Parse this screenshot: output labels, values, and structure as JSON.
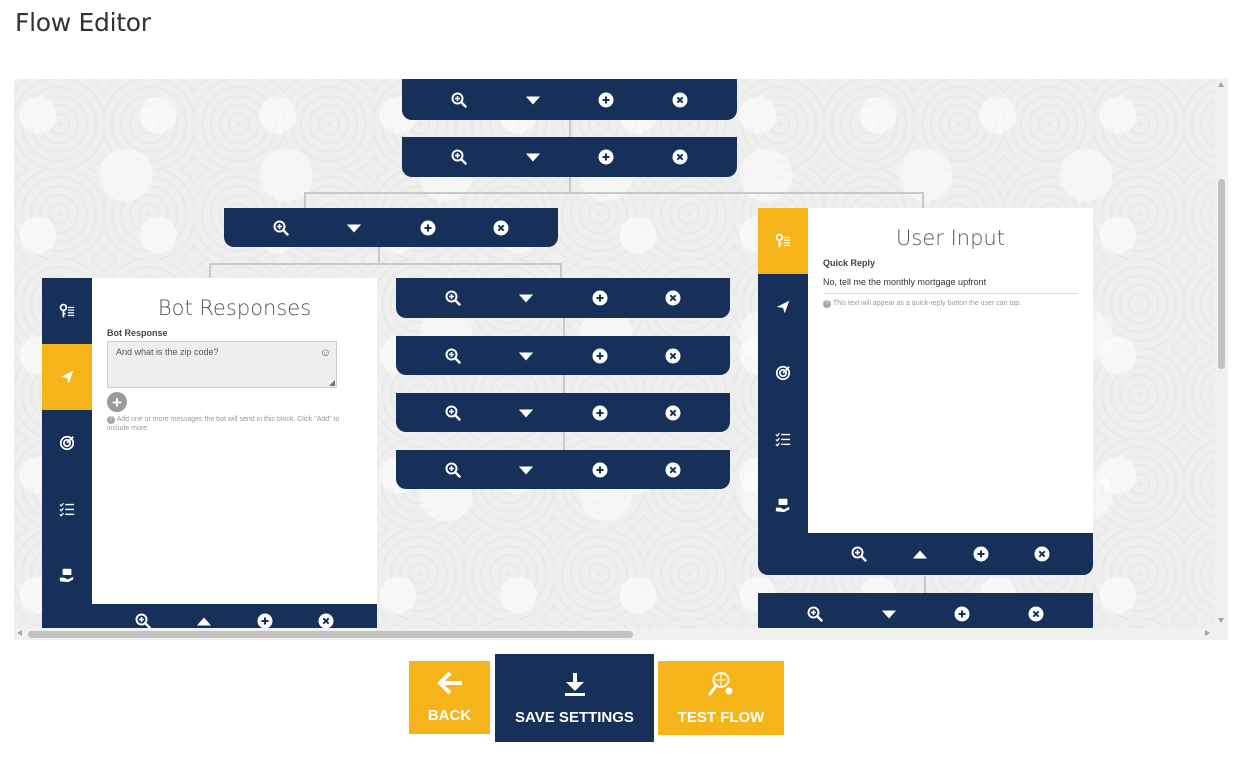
{
  "page": {
    "title": "Flow Editor"
  },
  "bot_panel": {
    "title": "Bot Responses",
    "field_label": "Bot Response",
    "message_value": "And what is the zip code?",
    "help_text": "Add one or more messages the bot will send in this block. Click \"Add\" to include more."
  },
  "user_panel": {
    "title": "User Input",
    "field_label": "Quick Reply",
    "reply_value": "No, tell me the monthly mortgage upfront",
    "help_text": "This text will appear as a quick-reply button the user can tap."
  },
  "toolbar_icons": [
    "zoom-in-icon",
    "caret-down-icon",
    "plus-circle-icon",
    "close-circle-icon"
  ],
  "sidebar_icons": [
    "keys-icon",
    "paper-plane-icon",
    "target-icon",
    "checklist-icon",
    "hand-card-icon"
  ],
  "buttons": {
    "back": "BACK",
    "save": "SAVE SETTINGS",
    "test": "TEST FLOW"
  },
  "colors": {
    "navy": "#17305a",
    "accent": "#f4b41a"
  }
}
